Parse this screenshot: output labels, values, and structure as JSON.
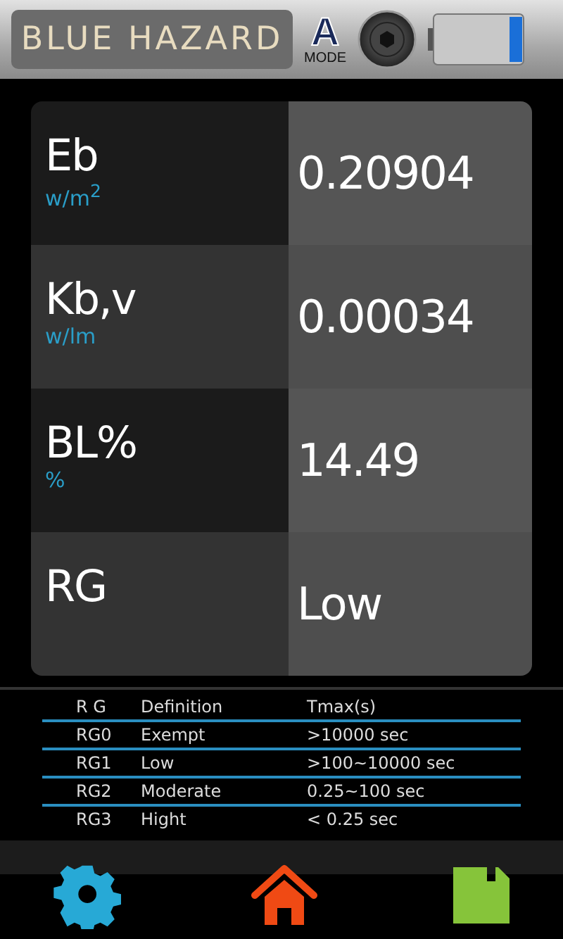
{
  "header": {
    "title": "BLUE HAZARD",
    "mode_letter": "A",
    "mode_label": "MODE"
  },
  "measurements": [
    {
      "name": "Eb",
      "unit": "w/m$^{2}$",
      "value": "0.20904"
    },
    {
      "name": "Kb,v",
      "unit": "w/lm",
      "value": "0.00034"
    },
    {
      "name": "BL%",
      "unit": "%",
      "value": "14.49"
    },
    {
      "name": "RG",
      "value": "Low"
    }
  ],
  "rg_table": {
    "columns": [
      "R G",
      "Definition",
      "Tmax(s)"
    ],
    "rows": [
      [
        "RG0",
        "Exempt",
        ">10000 sec"
      ],
      [
        "RG1",
        "Low",
        ">100~10000 sec"
      ],
      [
        "RG2",
        "Moderate",
        "0.25~100 sec"
      ],
      [
        "RG3",
        "Hight",
        "< 0.25 sec"
      ]
    ]
  }
}
